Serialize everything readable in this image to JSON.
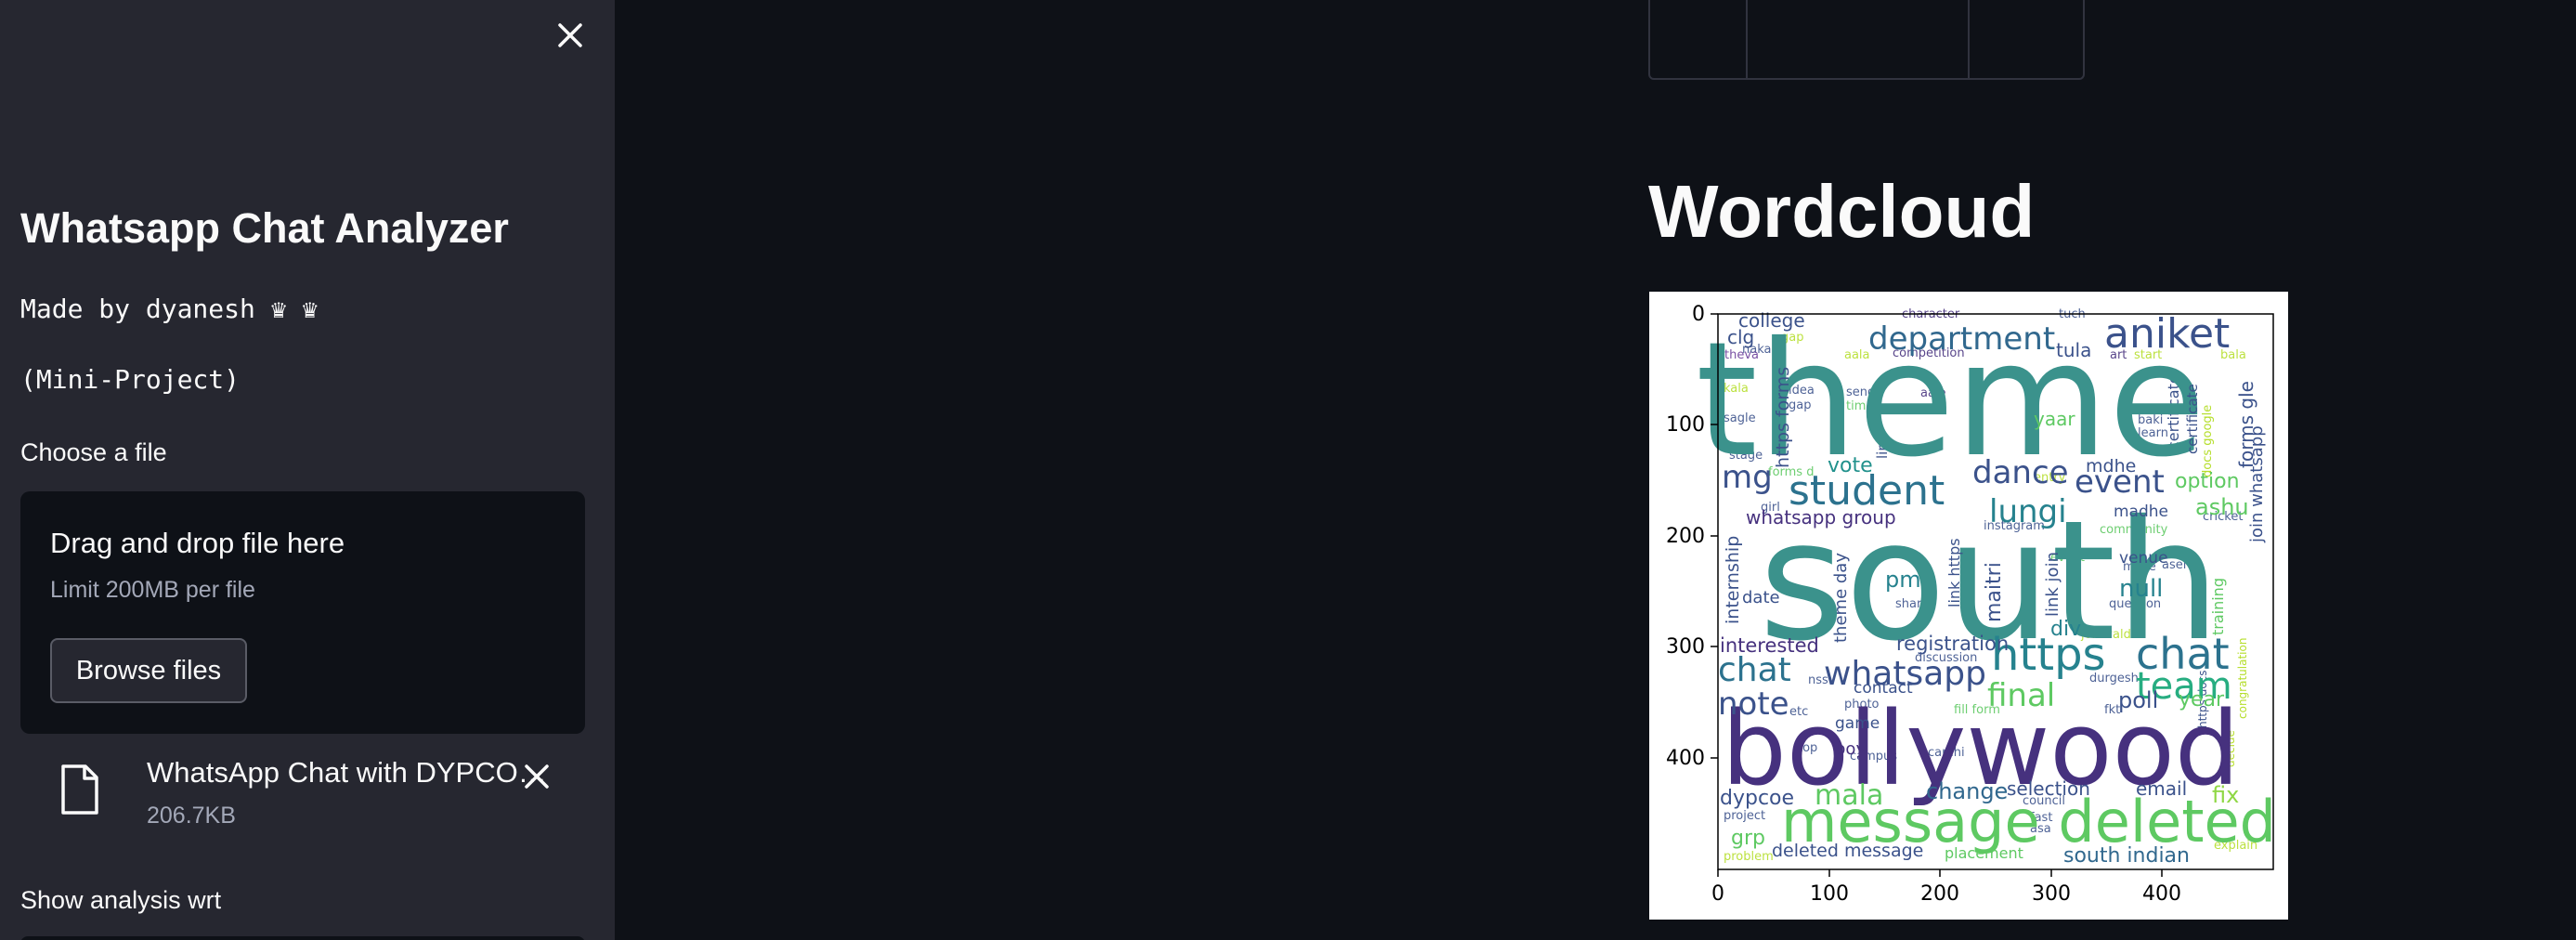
{
  "sidebar": {
    "close_icon": "close-icon",
    "title": "Whatsapp Chat Analyzer",
    "made_by": "Made by dyanesh ♛ ♛",
    "subtitle": "(Mini-Project)",
    "choose_file_label": "Choose a file",
    "dropzone": {
      "title": "Drag and drop file here",
      "limit": "Limit 200MB per file",
      "browse_label": "Browse files"
    },
    "uploaded_file": {
      "icon": "file-icon",
      "name": "WhatsApp Chat with DYPCO…",
      "size": "206.7KB",
      "remove_icon": "close-icon"
    },
    "analysis_label": "Show analysis wrt"
  },
  "main": {
    "heading": "Wordcloud",
    "wordcloud": {
      "x_ticks": [
        "0",
        "100",
        "200",
        "300",
        "400"
      ],
      "y_ticks": [
        "0",
        "100",
        "200",
        "300",
        "400"
      ],
      "palette": "viridis",
      "words": [
        {
          "text": "theme",
          "color": "#3b928c",
          "size": 1.0
        },
        {
          "text": "south",
          "color": "#3b928c",
          "size": 1.0
        },
        {
          "text": "bollywood",
          "color": "#46317e",
          "size": 0.75
        },
        {
          "text": "message deleted",
          "color": "#5ec962",
          "size": 0.5
        },
        {
          "text": "aniket",
          "color": "#3b528b",
          "size": 0.35
        },
        {
          "text": "department",
          "color": "#31688e",
          "size": 0.28
        },
        {
          "text": "student",
          "color": "#2c728e",
          "size": 0.35
        },
        {
          "text": "https",
          "color": "#26828e",
          "size": 0.35
        },
        {
          "text": "chat",
          "color": "#2c728e",
          "size": 0.35
        },
        {
          "text": "team",
          "color": "#27ad81",
          "size": 0.3
        },
        {
          "text": "dance",
          "color": "#3b528b",
          "size": 0.26
        },
        {
          "text": "event",
          "color": "#3b528b",
          "size": 0.26
        },
        {
          "text": "lungi",
          "color": "#26828e",
          "size": 0.26
        },
        {
          "text": "whatsapp",
          "color": "#3b528b",
          "size": 0.26
        },
        {
          "text": "mg",
          "color": "#3b528b",
          "size": 0.26
        },
        {
          "text": "note",
          "color": "#3b528b",
          "size": 0.26
        },
        {
          "text": "final",
          "color": "#5ec962",
          "size": 0.26
        },
        {
          "text": "mala",
          "color": "#5ec962",
          "size": 0.22
        },
        {
          "text": "fix",
          "color": "#8fd744",
          "size": 0.2
        },
        {
          "text": "south indian",
          "color": "#31688e",
          "size": 0.18
        },
        {
          "text": "selection",
          "color": "#3b528b",
          "size": 0.16
        },
        {
          "text": "email",
          "color": "#3b528b",
          "size": 0.16
        },
        {
          "text": "change",
          "color": "#31688e",
          "size": 0.18
        },
        {
          "text": "dypcoe",
          "color": "#3b528b",
          "size": 0.18
        },
        {
          "text": "poll",
          "color": "#3b528b",
          "size": 0.2
        },
        {
          "text": "year",
          "color": "#5ec962",
          "size": 0.18
        },
        {
          "text": "null",
          "color": "#26828e",
          "size": 0.2
        },
        {
          "text": "ashu",
          "color": "#5ec962",
          "size": 0.18
        },
        {
          "text": "option",
          "color": "#5ec962",
          "size": 0.18
        },
        {
          "text": "vote",
          "color": "#21918c",
          "size": 0.18
        },
        {
          "text": "registration",
          "color": "#3b528b",
          "size": 0.16
        },
        {
          "text": "interested",
          "color": "#46317e",
          "size": 0.16
        },
        {
          "text": "pm",
          "color": "#26828e",
          "size": 0.18
        },
        {
          "text": "div",
          "color": "#26828e",
          "size": 0.16
        },
        {
          "text": "date",
          "color": "#3b528b",
          "size": 0.14
        },
        {
          "text": "college",
          "color": "#3b528b",
          "size": 0.16
        },
        {
          "text": "clg",
          "color": "#3b528b",
          "size": 0.16
        },
        {
          "text": "tula",
          "color": "#3b528b",
          "size": 0.16
        },
        {
          "text": "yaar",
          "color": "#5ec962",
          "size": 0.16
        },
        {
          "text": "mdhe",
          "color": "#3b528b",
          "size": 0.15
        },
        {
          "text": "madhe",
          "color": "#3b528b",
          "size": 0.14
        },
        {
          "text": "venue",
          "color": "#3b528b",
          "size": 0.14
        },
        {
          "text": "contact",
          "color": "#3b528b",
          "size": 0.14
        },
        {
          "text": "game",
          "color": "#3b528b",
          "size": 0.14
        },
        {
          "text": "boy",
          "color": "#46317e",
          "size": 0.14
        },
        {
          "text": "grp",
          "color": "#5ec962",
          "size": 0.18
        },
        {
          "text": "deleted message",
          "color": "#3b528b",
          "size": 0.15
        },
        {
          "text": "placement",
          "color": "#5ec962",
          "size": 0.13
        },
        {
          "text": "whatsapp group",
          "color": "#46317e",
          "size": 0.16
        },
        {
          "text": "maitri",
          "color": "#3b528b",
          "size": 0.16
        },
        {
          "text": "internship",
          "color": "#3b528b",
          "size": 0.15
        },
        {
          "text": "forms gle",
          "color": "#3b528b",
          "size": 0.15
        },
        {
          "text": "join whatsapp",
          "color": "#3b528b",
          "size": 0.14
        },
        {
          "text": "training",
          "color": "#5ec962",
          "size": 0.13
        },
        {
          "text": "link join",
          "color": "#3b528b",
          "size": 0.14
        },
        {
          "text": "https forms",
          "color": "#3b528b",
          "size": 0.14
        },
        {
          "text": "certificate",
          "color": "#3b528b",
          "size": 0.12
        },
        {
          "text": "theme day",
          "color": "#3b528b",
          "size": 0.14
        },
        {
          "text": "link https",
          "color": "#3b528b",
          "size": 0.13
        }
      ]
    }
  }
}
